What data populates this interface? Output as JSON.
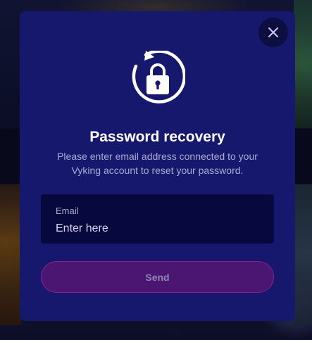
{
  "modal": {
    "title": "Password recovery",
    "subtitle": "Please enter email address connected to your Vyking account to reset your password.",
    "email": {
      "label": "Email",
      "placeholder": "Enter here",
      "value": ""
    },
    "send_label": "Send",
    "close_icon": "close-icon",
    "graphic_icon": "lock-reset-icon"
  },
  "colors": {
    "modal_bg": "#16186e",
    "input_bg": "#07083e",
    "send_bg": "#4b1671",
    "send_border": "#8a1f8a",
    "close_bg": "#0c0e40"
  }
}
